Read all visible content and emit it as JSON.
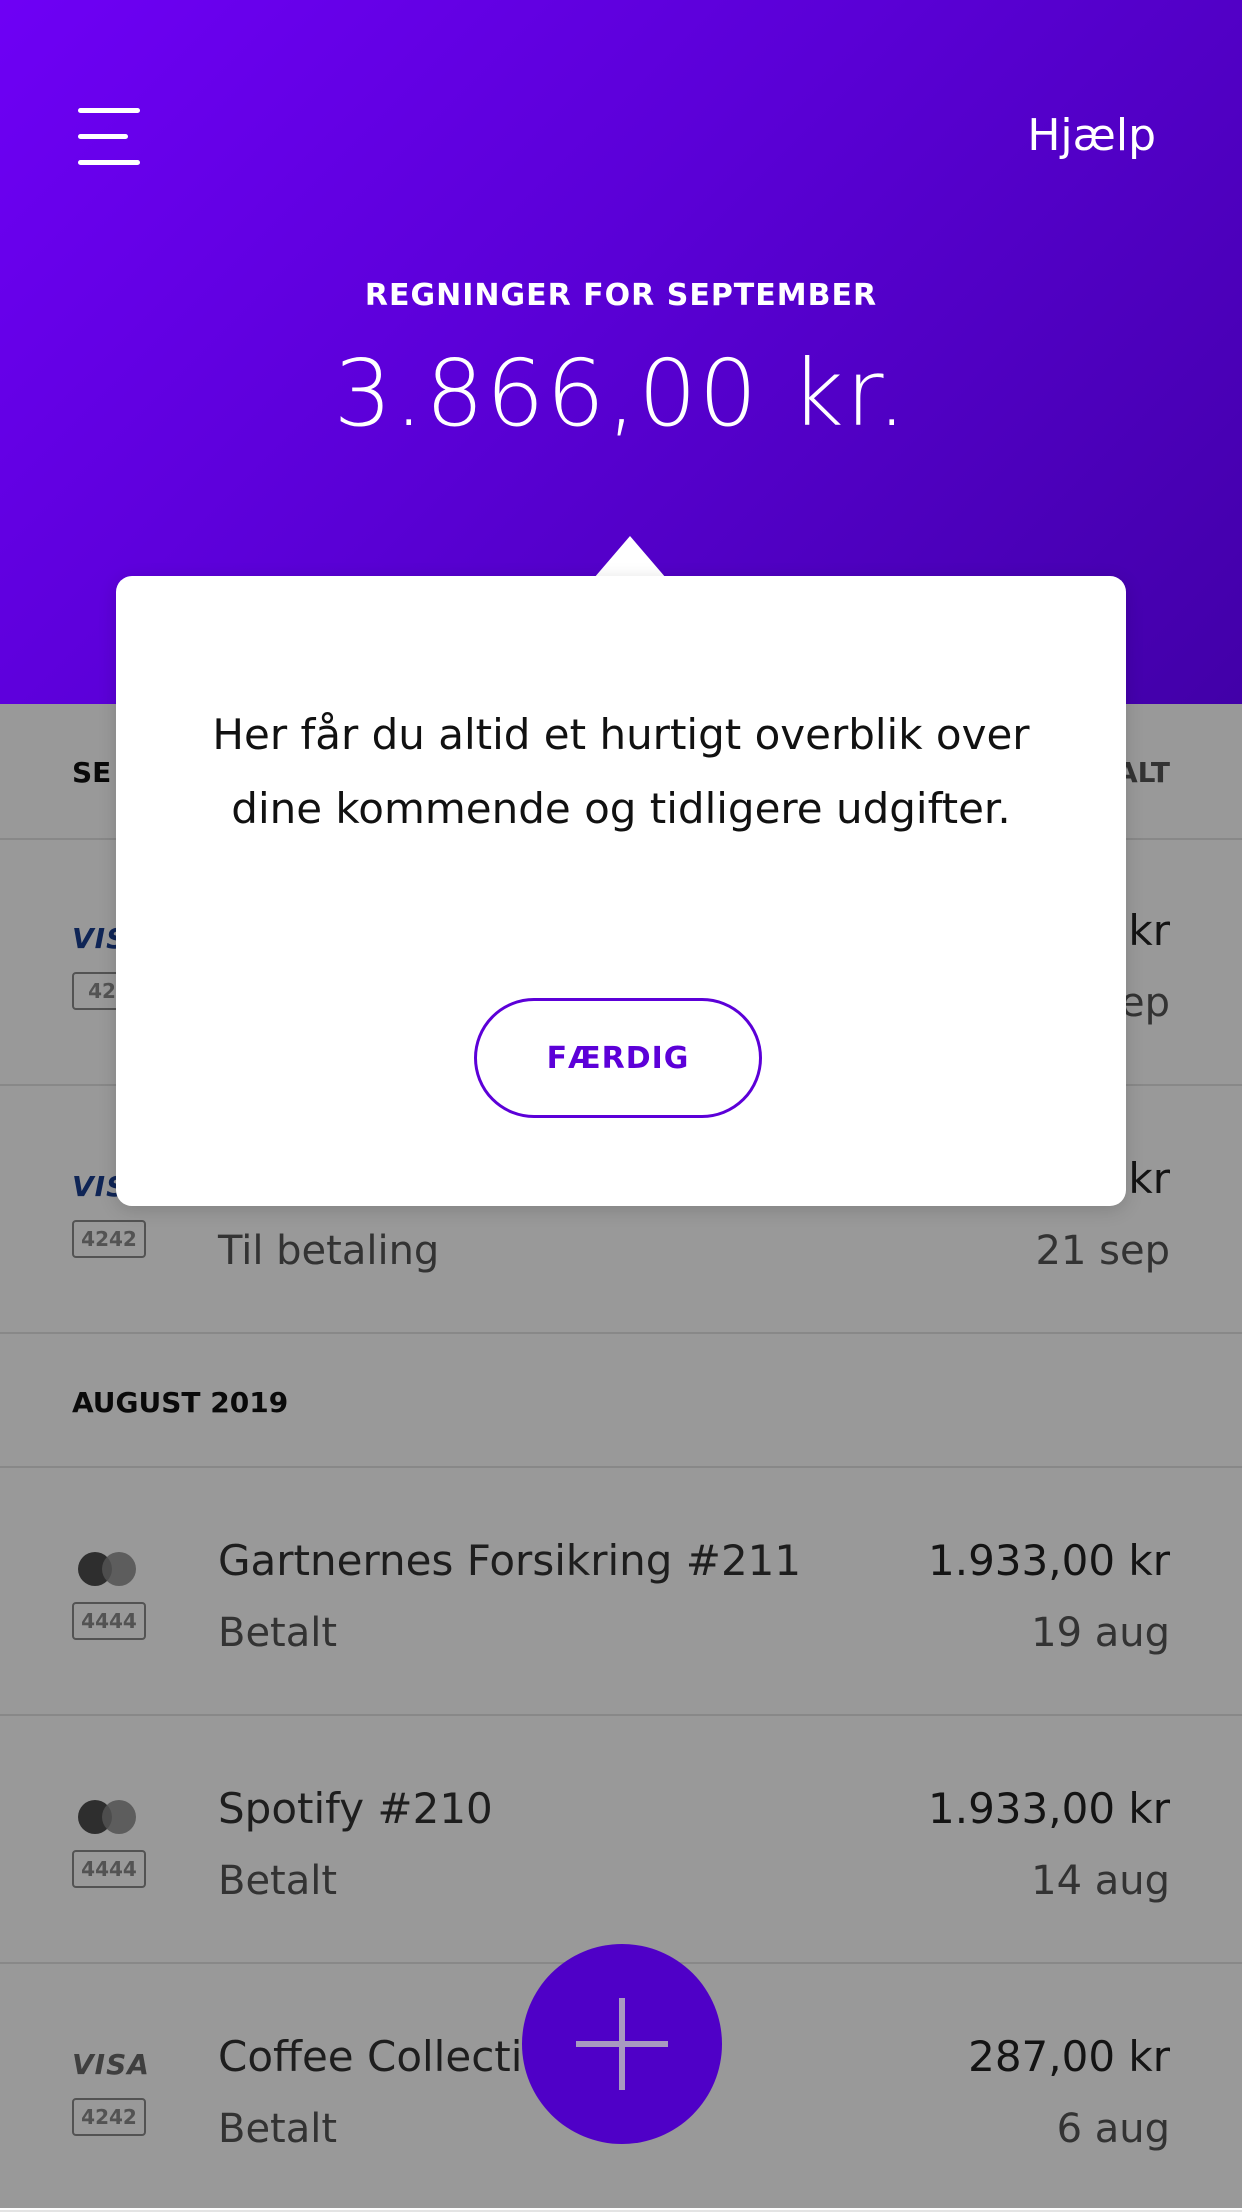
{
  "header": {
    "help_label": "Hjælp",
    "month_label": "REGNINGER FOR SEPTEMBER",
    "total_amount": "3.866,00 kr."
  },
  "tabs": {
    "left_label": "SE",
    "right_label": "ALT"
  },
  "september_bills": [
    {
      "card_brand": "VIS",
      "card_last4": "424",
      "title": "",
      "status": "",
      "amount": "kr",
      "date": "ep"
    },
    {
      "card_brand": "VIS",
      "card_last4": "4242",
      "title": "",
      "status": "Til betaling",
      "amount": "kr",
      "date": "21 sep"
    }
  ],
  "august_section": {
    "title": "AUGUST 2019"
  },
  "august_bills": [
    {
      "card_brand": "mastercard",
      "card_last4": "4444",
      "title": "Gartnernes Forsikring #211",
      "status": "Betalt",
      "amount": "1.933,00 kr",
      "date": "19 aug"
    },
    {
      "card_brand": "mastercard",
      "card_last4": "4444",
      "title": "Spotify #210",
      "status": "Betalt",
      "amount": "1.933,00 kr",
      "date": "14 aug"
    },
    {
      "card_brand": "VISA",
      "card_last4": "4242",
      "title": "Coffee Collecti",
      "status": "Betalt",
      "amount": "287,00 kr",
      "date": "6 aug"
    }
  ],
  "popup": {
    "message": "Her får du altid et hurtigt overblik over dine kommende og tidligere udgifter.",
    "done_label": "FÆRDIG"
  },
  "icons": {
    "menu": "menu-icon",
    "add": "plus-icon"
  },
  "colors": {
    "brand_purple": "#5c00d8",
    "fab_purple": "#4f00c7"
  }
}
